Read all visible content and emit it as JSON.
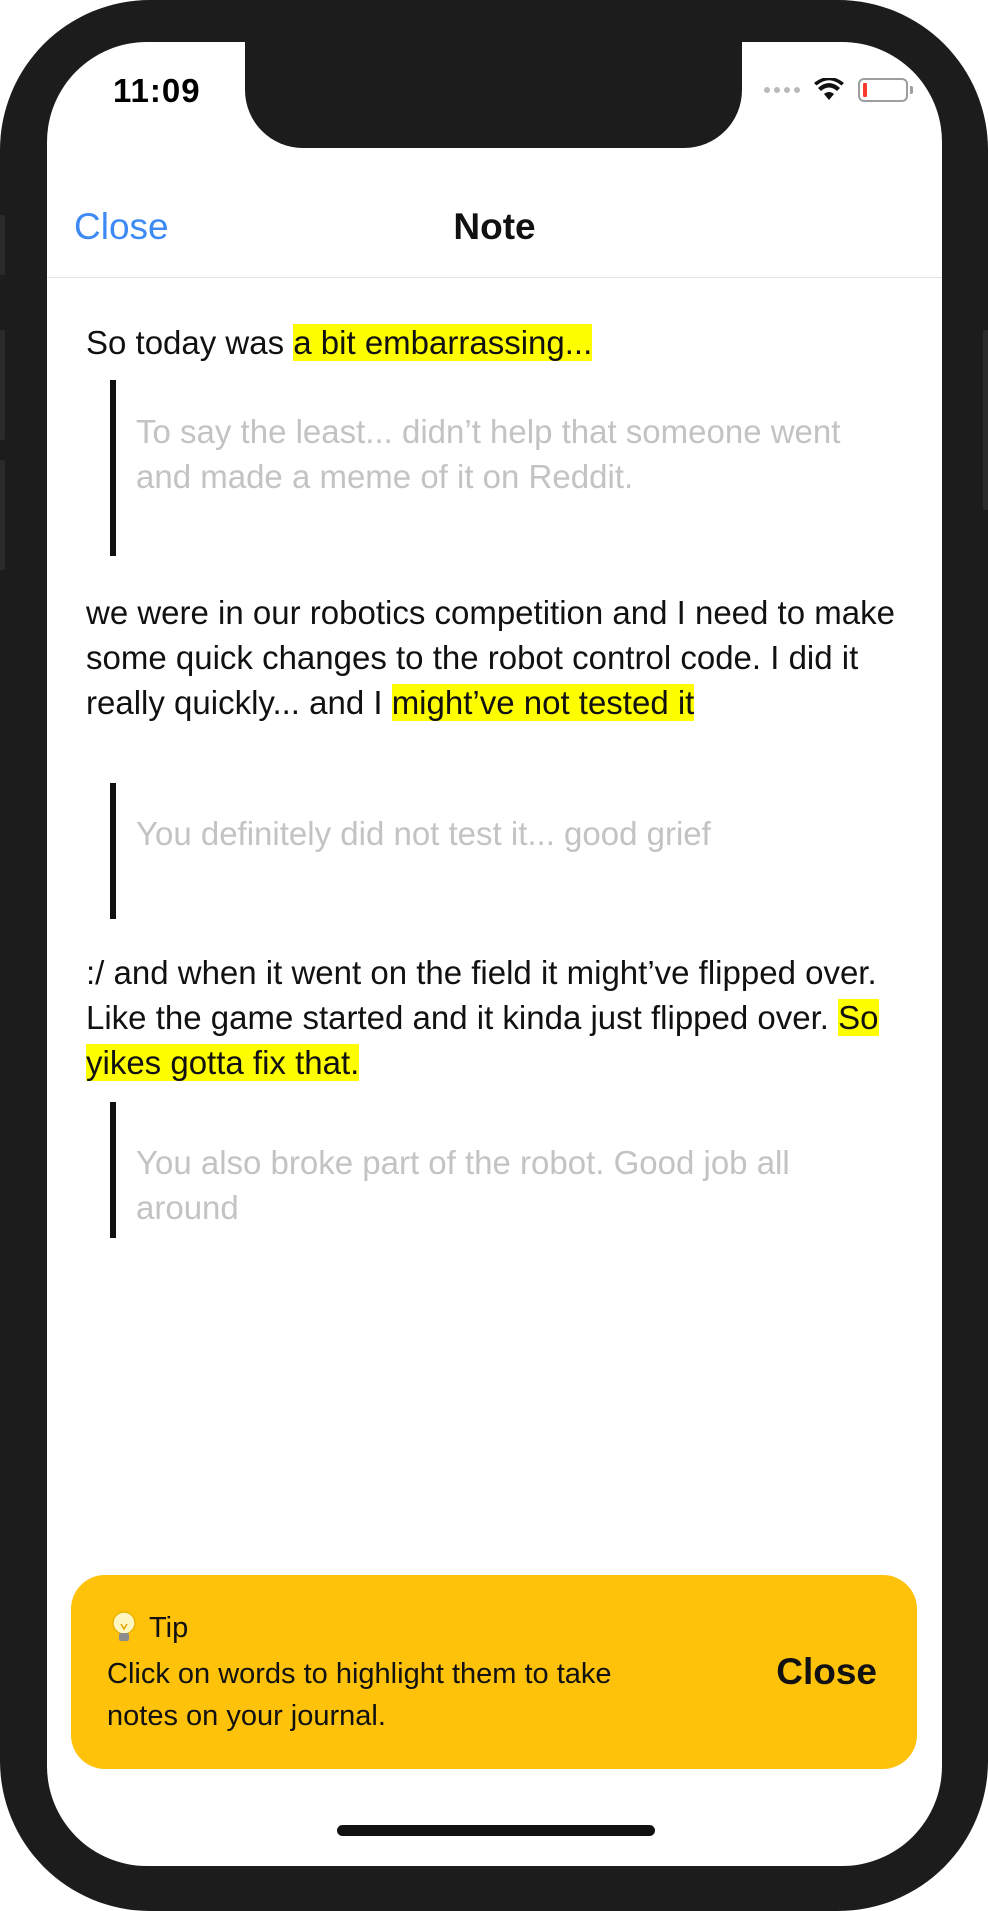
{
  "status_bar": {
    "time": "11:09"
  },
  "nav": {
    "close_label": "Close",
    "title": "Note"
  },
  "journal": {
    "p1_plain": "So today was ",
    "p1_highlight": "a bit embarrassing...",
    "q1": "To say the least... didn’t help that someone went and made a meme of it on Reddit.",
    "p2_plain": "we were in our robotics competition and I need to make some quick changes to the robot control code. I did it really quickly... and I ",
    "p2_highlight": "might’ve not tested it",
    "q2": "You definitely did not test it... good grief",
    "p3_plain": ":/ and when it went on the field it might’ve flipped over. Like the game started and it kinda just flipped over. ",
    "p3_highlight": "So yikes gotta fix that.",
    "q3": "You also broke part of the robot. Good job all around"
  },
  "tip": {
    "icon": "lightbulb-icon",
    "title": "Tip",
    "body": "Click on words to highlight them to take notes on your journal.",
    "close_label": "Close",
    "background": "#ffc20a"
  },
  "colors": {
    "accent": "#3d8af5",
    "highlight": "#fffe00",
    "quote_text": "#c3c3c3"
  }
}
